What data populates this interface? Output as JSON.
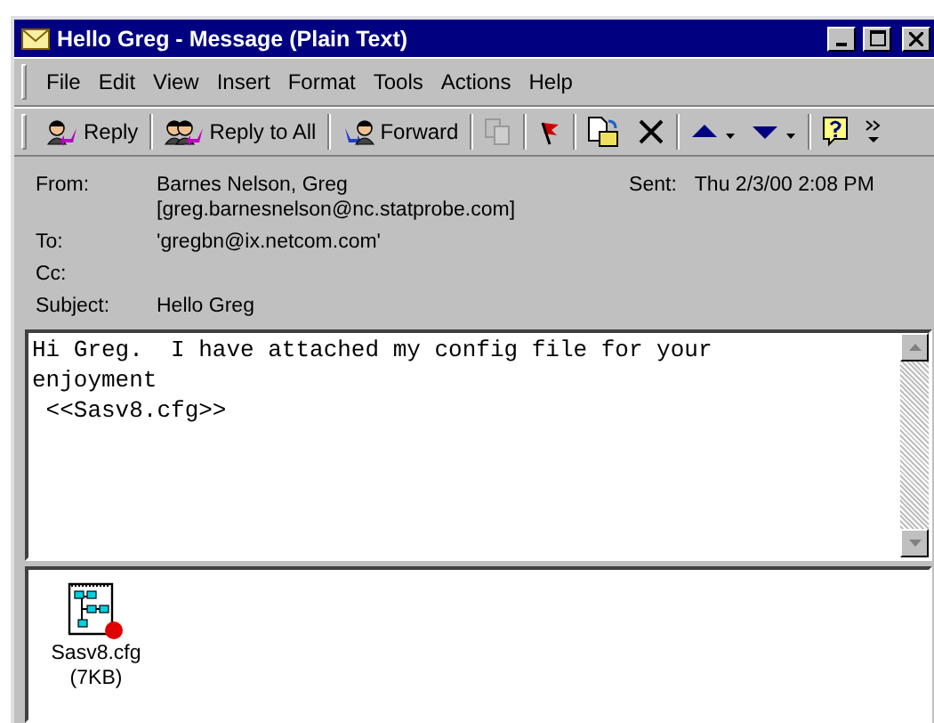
{
  "window": {
    "title": "Hello Greg - Message (Plain Text)"
  },
  "menu": [
    "File",
    "Edit",
    "View",
    "Insert",
    "Format",
    "Tools",
    "Actions",
    "Help"
  ],
  "toolbar": [
    {
      "kind": "reply",
      "label": "Reply",
      "disabled": false
    },
    {
      "kind": "reply-all",
      "label": "Reply to All",
      "disabled": false
    },
    {
      "kind": "forward",
      "label": "Forward",
      "disabled": false
    },
    {
      "kind": "copy",
      "disabled": true
    },
    {
      "kind": "flag",
      "disabled": false
    },
    {
      "kind": "move",
      "disabled": false
    },
    {
      "kind": "delete",
      "disabled": false
    },
    {
      "kind": "previous",
      "disabled": false
    },
    {
      "kind": "next",
      "disabled": false
    },
    {
      "kind": "help",
      "disabled": false
    },
    {
      "kind": "more",
      "disabled": false
    }
  ],
  "header": {
    "from_label": "From:",
    "from": [
      "Barnes Nelson, Greg",
      "[greg.barnesnelson@nc.statprobe.com]"
    ],
    "sent_label": "Sent:",
    "sent": "Thu 2/3/00 2:08 PM",
    "to_label": "To:",
    "to": "'gregbn@ix.netcom.com'",
    "cc_label": "Cc:",
    "subject_label": "Subject:",
    "subject": "Hello Greg"
  },
  "body": [
    "Hi Greg.  I have attached my config file for your",
    "enjoyment",
    " <<Sasv8.cfg>>"
  ],
  "attachments": [
    {
      "name": "Sasv8.cfg",
      "size": "(7KB)"
    }
  ]
}
